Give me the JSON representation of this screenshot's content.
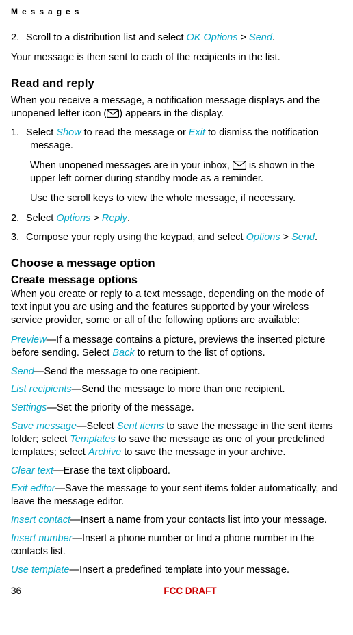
{
  "header": "Messages",
  "step2": {
    "num": "2.",
    "t1": "Scroll to a distribution list and select ",
    "ok": "OK",
    "sp": "  ",
    "options": "Options",
    "gt": " > ",
    "send": "Send",
    "dot": "."
  },
  "sentAll": "Your message is then sent to each of the recipients in the list.",
  "readReply": "Read and reply",
  "rr_intro1": "When you receive a message, a notification message displays and the unopened letter icon (",
  "rr_intro2": ") appears in the display.",
  "rr1": {
    "num": "1.",
    "t1": "Select ",
    "show": "Show",
    "t2": " to read the message or ",
    "exit": "Exit",
    "t3": " to dismiss the notification message."
  },
  "rr_inbox1": "When unopened messages are in your inbox, ",
  "rr_inbox2": " is shown in the upper left corner during standby mode as a reminder.",
  "rr_scroll": "Use the scroll keys to view the whole message, if necessary.",
  "rr2": {
    "num": "2.",
    "t1": "Select ",
    "options": "Options",
    "gt": " > ",
    "reply": "Reply",
    "dot": "."
  },
  "rr3": {
    "num": "3.",
    "t1": "Compose your reply using the keypad, and select ",
    "options": "Options",
    "gt": " > ",
    "send": "Send",
    "dot": "."
  },
  "choose": "Choose a message option",
  "createOpts": "Create message options",
  "createIntro": "When you create or reply to a text message, depending on the mode of text input you are using and the features supported by your wireless service provider, some or all of the following options are available:",
  "opts": {
    "preview": {
      "k": "Preview",
      "t1": "—If a message contains a picture, previews the inserted picture before sending. Select ",
      "back": "Back",
      "t2": " to return to the list of options."
    },
    "send": {
      "k": "Send",
      "t": "—Send the message to one recipient."
    },
    "list": {
      "k": "List recipients",
      "t": "—Send the message to more than one recipient."
    },
    "settings": {
      "k": "Settings",
      "t": "—Set the priority of the message."
    },
    "save": {
      "k": "Save message",
      "t1": "—Select ",
      "sent": "Sent items",
      "t2": " to save the message in the sent items folder; select ",
      "templates": "Templates",
      "t3": " to save the message as one of your predefined templates; select ",
      "archive": "Archive",
      "t4": " to save the message in your archive."
    },
    "clear": {
      "k": "Clear text",
      "t": "—Erase the text clipboard."
    },
    "exitEd": {
      "k": "Exit editor",
      "t": "—Save the message to your sent items folder automatically, and leave the message editor."
    },
    "insContact": {
      "k": "Insert contact",
      "t": "—Insert a name from your contacts list into your message."
    },
    "insNumber": {
      "k": "Insert number",
      "t": "—Insert a phone number or find a phone number in the contacts list."
    },
    "useTemplate": {
      "k": "Use template",
      "t": "—Insert a predefined template into your message."
    }
  },
  "footer": {
    "page": "36",
    "fcc": "FCC DRAFT"
  }
}
